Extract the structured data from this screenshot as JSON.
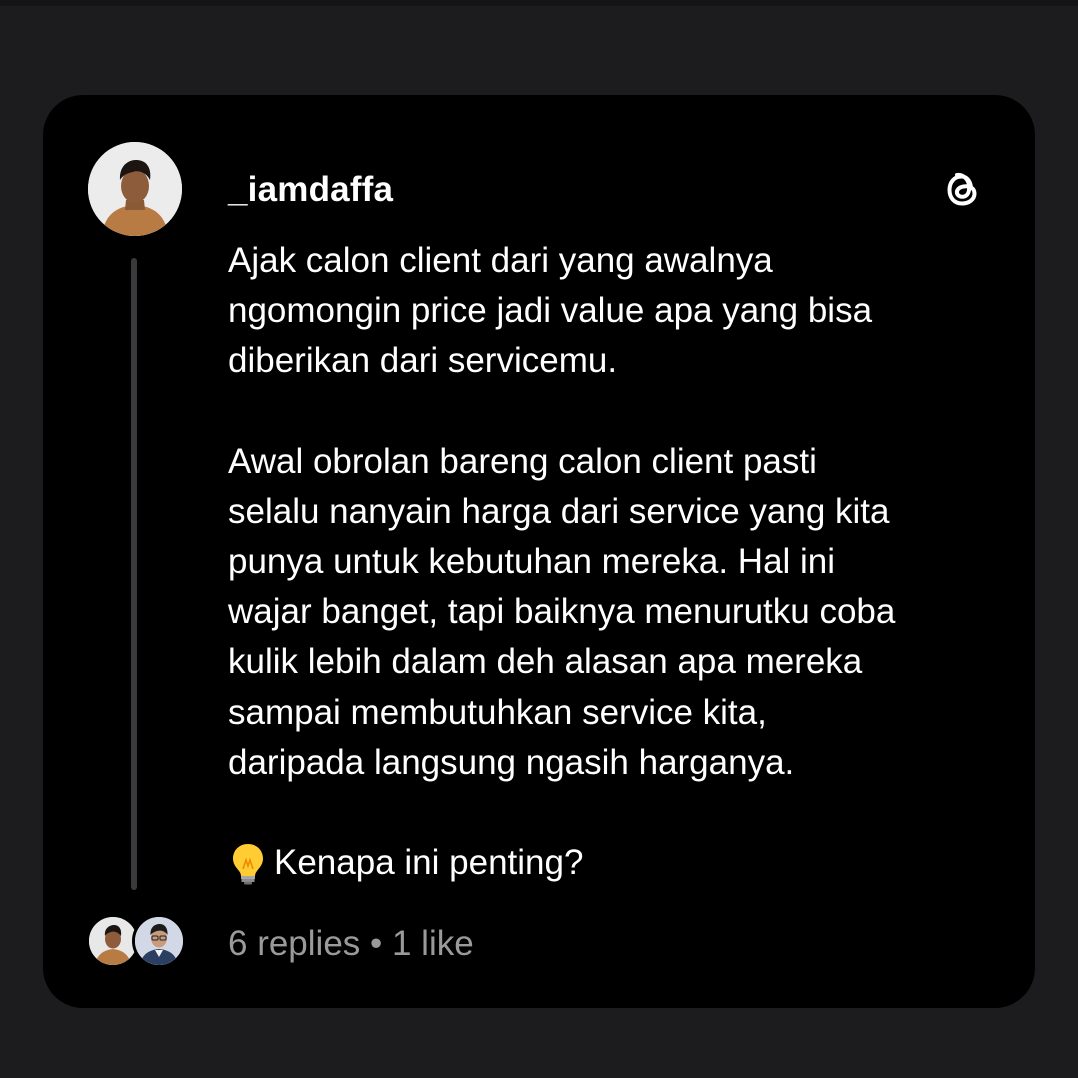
{
  "post": {
    "username": "_iamdaffa",
    "paragraphs": [
      "Ajak calon client dari yang awalnya\nngomongin price jadi value apa yang bisa\ndiberikan dari servicemu.",
      "Awal obrolan bareng calon client pasti\nselalu nanyain harga dari service yang kita\npunya untuk kebutuhan mereka. Hal ini\nwajar banget, tapi baiknya menurutku coba\nkulik lebih dalam deh alasan apa mereka\nsampai membutuhkan service kita,\ndaripada langsung ngasih harganya."
    ],
    "highlight_text": "Kenapa ini penting?",
    "highlight_icon": "lightbulb-icon"
  },
  "footer": {
    "stats": "6 replies • 1 like"
  },
  "icons": {
    "brand": "threads-logo-icon"
  },
  "colors": {
    "background": "#1c1c1e",
    "card": "#000000",
    "text": "#ffffff",
    "muted_text": "#9a9a9a",
    "thread_line": "#3a3a3c"
  }
}
